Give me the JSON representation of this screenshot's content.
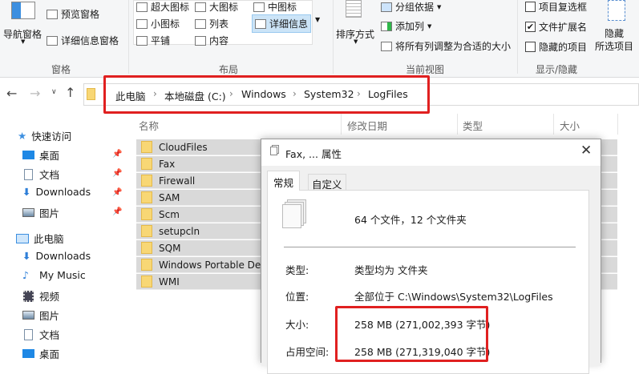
{
  "ribbon": {
    "pane": {
      "nav_pane": "导航窗格",
      "preview_pane": "预览窗格",
      "details_pane": "详细信息窗格",
      "group": "窗格"
    },
    "layout": {
      "items": [
        "超大图标",
        "大图标",
        "中图标",
        "小图标",
        "列表",
        "详细信息",
        "平铺",
        "内容"
      ],
      "selected": "详细信息",
      "group": "布局"
    },
    "current_view": {
      "sort_by": "排序方式",
      "group_by": "分组依据",
      "add_column": "添加列",
      "fit_columns": "将所有列调整为合适的大小",
      "group": "当前视图"
    },
    "show_hide": {
      "item_checkboxes": "项目复选框",
      "item_checkboxes_checked": false,
      "file_ext": "文件扩展名",
      "file_ext_checked": true,
      "hidden_items": "隐藏的项目",
      "hidden_items_checked": false,
      "hide_selected_1": "隐藏",
      "hide_selected_2": "所选项目",
      "group": "显示/隐藏"
    }
  },
  "breadcrumb": [
    "此电脑",
    "本地磁盘 (C:)",
    "Windows",
    "System32",
    "LogFiles"
  ],
  "columns": [
    "名称",
    "修改日期",
    "类型",
    "大小"
  ],
  "sidebar": {
    "quick_access": "快速访问",
    "quick_items": [
      "桌面",
      "文档",
      "Downloads",
      "图片"
    ],
    "this_pc": "此电脑",
    "pc_items": [
      "Downloads",
      "My Music",
      "视频",
      "图片",
      "文档",
      "桌面"
    ]
  },
  "files": [
    "CloudFiles",
    "Fax",
    "Firewall",
    "SAM",
    "Scm",
    "setupcln",
    "SQM",
    "Windows Portable Dev",
    "WMI"
  ],
  "dialog": {
    "title": "Fax, ... 属性",
    "tabs": [
      "常规",
      "自定义"
    ],
    "summary": "64 个文件，12 个文件夹",
    "type_label": "类型:",
    "type_value": "类型均为 文件夹",
    "location_label": "位置:",
    "location_value": "全部位于 C:\\Windows\\System32\\LogFiles",
    "size_label": "大小:",
    "size_value": "258 MB (271,002,393 字节)",
    "disk_label": "占用空间:",
    "disk_value": "258 MB (271,319,040 字节)"
  }
}
